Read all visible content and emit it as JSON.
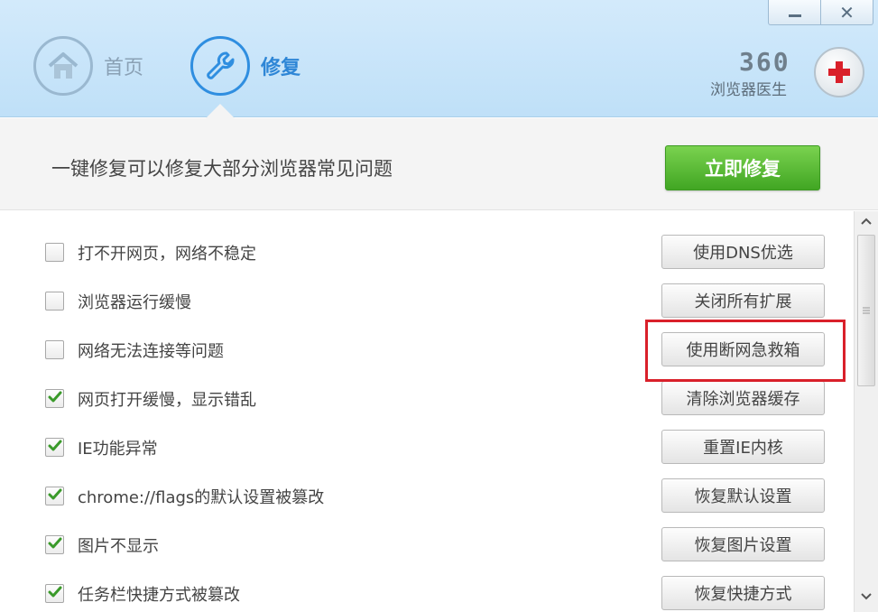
{
  "window": {
    "minimize_icon": "minimize-icon",
    "close_label": "✕"
  },
  "nav": {
    "home_label": "首页",
    "repair_label": "修复"
  },
  "brand": {
    "name": "360",
    "subtitle": "浏览器医生"
  },
  "banner": {
    "text": "一键修复可以修复大部分浏览器常见问题",
    "button_label": "立即修复"
  },
  "items": [
    {
      "label": "打不开网页，网络不稳定",
      "checked": false,
      "action": "使用DNS优选"
    },
    {
      "label": "浏览器运行缓慢",
      "checked": false,
      "action": "关闭所有扩展"
    },
    {
      "label": "网络无法连接等问题",
      "checked": false,
      "action": "使用断网急救箱"
    },
    {
      "label": "网页打开缓慢，显示错乱",
      "checked": true,
      "action": "清除浏览器缓存"
    },
    {
      "label": "IE功能异常",
      "checked": true,
      "action": "重置IE内核"
    },
    {
      "label": "chrome://flags的默认设置被篡改",
      "checked": true,
      "action": "恢复默认设置"
    },
    {
      "label": "图片不显示",
      "checked": true,
      "action": "恢复图片设置"
    },
    {
      "label": "任务栏快捷方式被篡改",
      "checked": true,
      "action": "恢复快捷方式"
    }
  ],
  "colors": {
    "accent": "#2e86d6",
    "primary_button": "#41a623",
    "highlight": "#d9202a",
    "check": "#3a9a2a"
  }
}
